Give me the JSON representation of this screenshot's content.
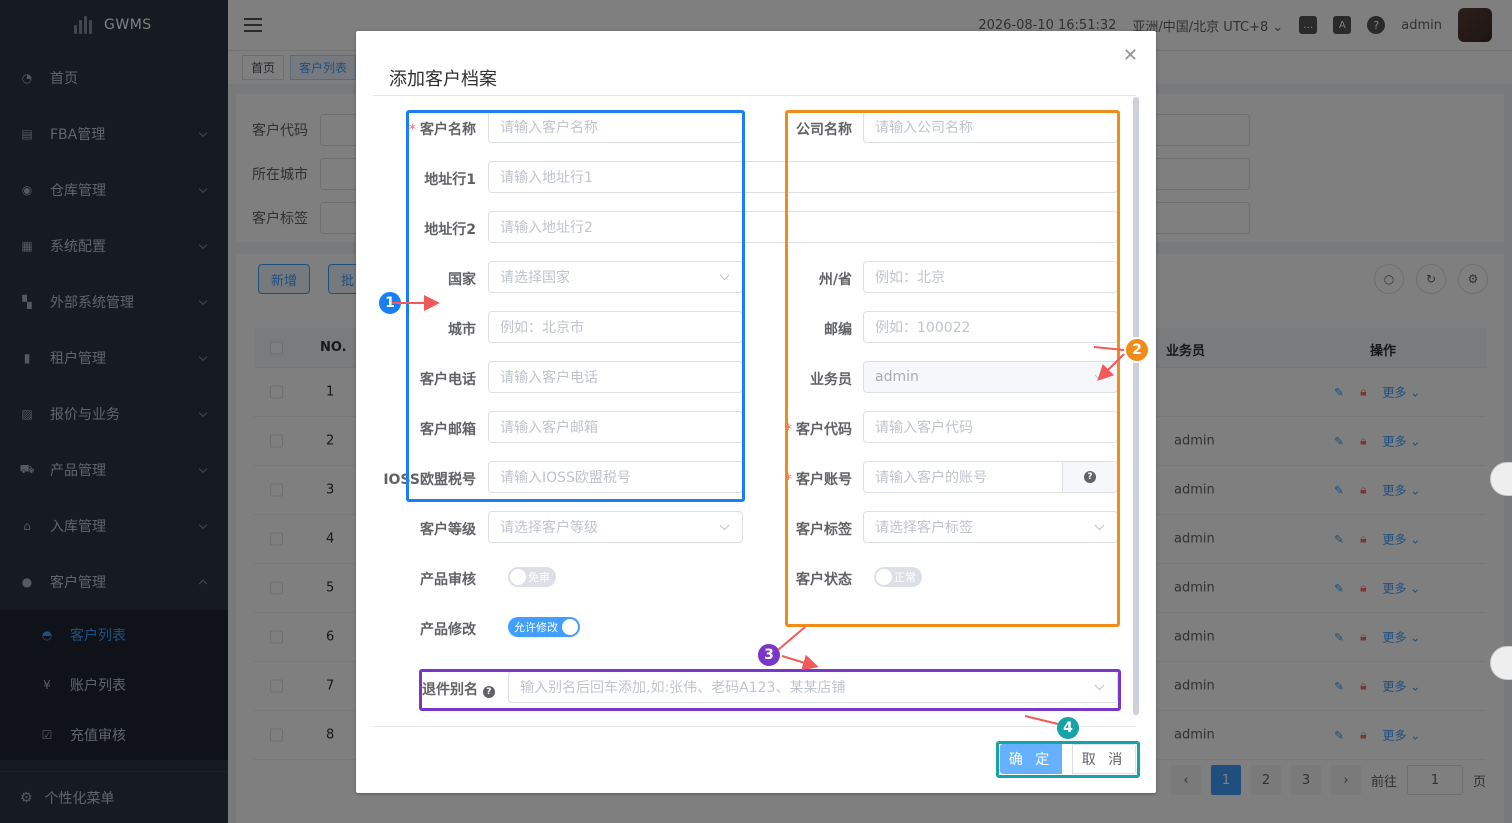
{
  "app": {
    "name": "GWMS"
  },
  "sidebar": {
    "items": [
      {
        "label": "首页",
        "icon": "dashboard-icon"
      },
      {
        "label": "FBA管理",
        "icon": "doc-icon"
      },
      {
        "label": "仓库管理",
        "icon": "globe-icon"
      },
      {
        "label": "系统配置",
        "icon": "config-icon"
      },
      {
        "label": "外部系统管理",
        "icon": "grid-icon"
      },
      {
        "label": "租户管理",
        "icon": "chart-icon"
      },
      {
        "label": "报价与业务",
        "icon": "quote-icon"
      },
      {
        "label": "产品管理",
        "icon": "cart-icon"
      },
      {
        "label": "入库管理",
        "icon": "home-icon"
      },
      {
        "label": "客户管理",
        "icon": "user-icon"
      }
    ],
    "sub_items": [
      {
        "label": "客户列表",
        "active": true
      },
      {
        "label": "账户列表",
        "active": false
      },
      {
        "label": "充值审核",
        "active": false
      }
    ],
    "bottom": "个性化菜单"
  },
  "topbar": {
    "datetime": "2026-08-10 16:51:32",
    "timezone": "亚洲/中国/北京 UTC+8",
    "user": "admin"
  },
  "tags": [
    "首页",
    "客户列表"
  ],
  "filters": [
    "客户代码",
    "所在城市",
    "客户标签"
  ],
  "filter_placeholders": [
    "请输",
    "请输",
    "请选"
  ],
  "table": {
    "add_button": "新增",
    "batch_button": "批",
    "headers": {
      "no": "NO.",
      "salesman": "业务员",
      "actions": "操作"
    },
    "rows": [
      {
        "no": "1",
        "salesman": ""
      },
      {
        "no": "2",
        "salesman": "admin"
      },
      {
        "no": "3",
        "salesman": "admin"
      },
      {
        "no": "4",
        "salesman": "admin"
      },
      {
        "no": "5",
        "salesman": "admin"
      },
      {
        "no": "6",
        "salesman": "admin"
      },
      {
        "no": "7",
        "salesman": "admin"
      },
      {
        "no": "8",
        "salesman": "admin"
      }
    ],
    "more_label": "更多",
    "pager": {
      "pages": [
        "1",
        "2",
        "3"
      ],
      "current": "1",
      "goto_label": "前往",
      "goto_value": "1",
      "page_suffix": "页"
    }
  },
  "dialog": {
    "title": "添加客户档案",
    "left": [
      {
        "label": "客户名称",
        "placeholder": "请输入客户名称",
        "required": true
      },
      {
        "label": "地址行1",
        "placeholder": "请输入地址行1"
      },
      {
        "label": "地址行2",
        "placeholder": "请输入地址行2"
      },
      {
        "label": "国家",
        "placeholder": "请选择国家",
        "select": true
      },
      {
        "label": "城市",
        "placeholder": "例如：北京市"
      },
      {
        "label": "客户电话",
        "placeholder": "请输入客户电话"
      },
      {
        "label": "客户邮箱",
        "placeholder": "请输入客户邮箱"
      },
      {
        "label": "IOSS欧盟税号",
        "placeholder": "请输入IOSS欧盟税号"
      },
      {
        "label": "客户等级",
        "placeholder": "请选择客户等级",
        "select": true
      }
    ],
    "right": [
      {
        "label": "公司名称",
        "placeholder": "请输入公司名称"
      },
      {
        "label": "州/省",
        "placeholder": "例如：北京"
      },
      {
        "label": "邮编",
        "placeholder": "例如：100022"
      },
      {
        "label": "业务员",
        "value": "admin",
        "select": true,
        "disabled": true
      },
      {
        "label": "客户代码",
        "placeholder": "请输入客户代码",
        "required": true
      },
      {
        "label": "客户账号",
        "placeholder": "请输入客户的账号",
        "required": true
      },
      {
        "label": "客户标签",
        "placeholder": "请选择客户标签",
        "select": true
      }
    ],
    "switches": {
      "product_review": {
        "label": "产品审核",
        "text": "免审",
        "on": false
      },
      "product_modify": {
        "label": "产品修改",
        "text": "允许修改",
        "on": true
      },
      "customer_status": {
        "label": "客户状态",
        "text": "正常",
        "on": false
      }
    },
    "alias": {
      "label": "退件别名",
      "placeholder": "输入别名后回车添加,如:张伟、老码A123、某某店铺"
    },
    "confirm": "确 定",
    "cancel": "取 消"
  },
  "annotations": {
    "badges": [
      "1",
      "2",
      "3",
      "4"
    ],
    "colors": {
      "blue": "#1a7ef5",
      "orange": "#f28c18",
      "purple": "#7a35c9",
      "teal": "#16a3a8",
      "arrow": "#f25a5a"
    }
  }
}
